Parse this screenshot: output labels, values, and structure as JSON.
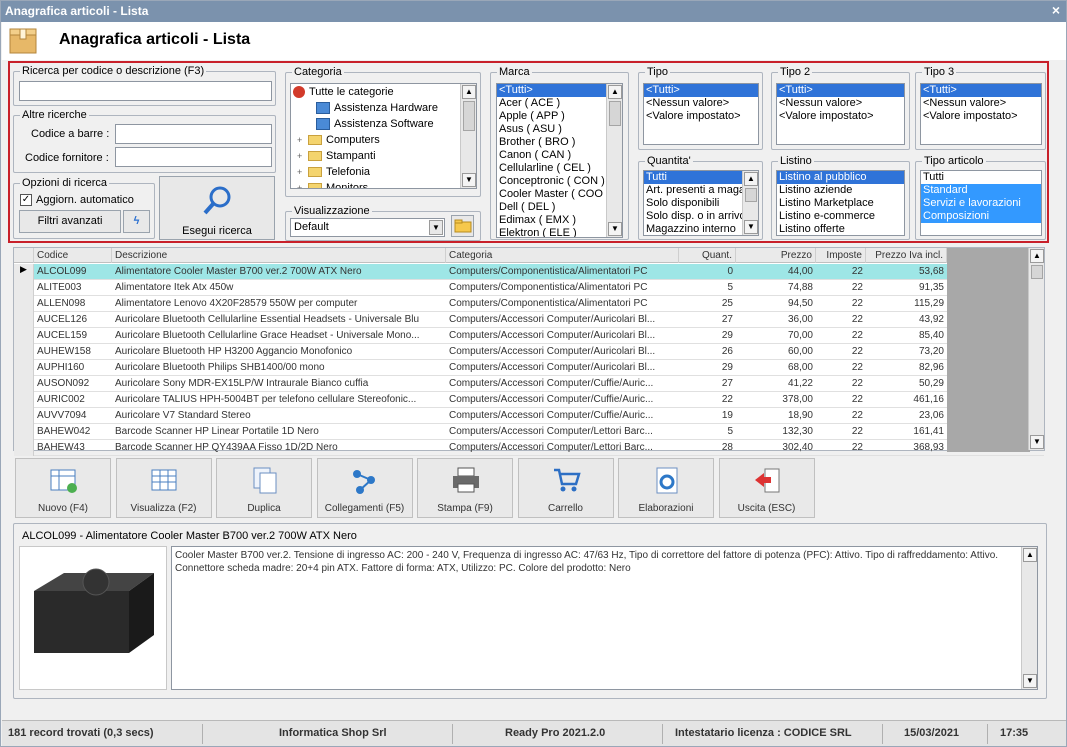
{
  "window": {
    "title": "Anagrafica articoli  - Lista",
    "close": "×"
  },
  "header": {
    "title": "Anagrafica articoli  - Lista"
  },
  "search": {
    "title": "Ricerca per codice o descrizione (F3)",
    "value": "",
    "altre_title": "Altre ricerche",
    "codice_barre_label": "Codice a barre :",
    "codice_fornitore_label": "Codice fornitore :",
    "opzioni_title": "Opzioni di ricerca",
    "aggiorn_label": "Aggiorn. automatico",
    "aggiorn_checked": true,
    "filtri_label": "Filtri avanzati",
    "esegui_label": "Esegui ricerca"
  },
  "categoria": {
    "title": "Categoria",
    "items": [
      {
        "label": "Tutte le categorie",
        "icon": "strawberry-icon",
        "level": 0,
        "expand": ""
      },
      {
        "label": "Assistenza Hardware",
        "icon": "network-icon",
        "level": 1,
        "expand": ""
      },
      {
        "label": "Assistenza Software",
        "icon": "network-icon",
        "level": 1,
        "expand": ""
      },
      {
        "label": "Computers",
        "icon": "folder-icon",
        "level": 1,
        "expand": "+"
      },
      {
        "label": "Stampanti",
        "icon": "folder-icon",
        "level": 1,
        "expand": "+"
      },
      {
        "label": "Telefonia",
        "icon": "folder-icon",
        "level": 1,
        "expand": "+"
      },
      {
        "label": "Monitors",
        "icon": "folder-icon",
        "level": 1,
        "expand": "+"
      }
    ]
  },
  "visualizzazione": {
    "title": "Visualizzazione",
    "value": "Default"
  },
  "marca": {
    "title": "Marca",
    "items": [
      "<Tutti>",
      "Acer ( ACE )",
      "Apple ( APP )",
      "Asus ( ASU )",
      "Brother ( BRO )",
      "Canon ( CAN )",
      "Cellularline ( CEL )",
      "Conceptronic ( CON )",
      "Cooler Master ( COO )",
      "Dell ( DEL )",
      "Edimax ( EMX )",
      "Elektron ( ELE )"
    ],
    "selected": 0
  },
  "tipo": {
    "title": "Tipo",
    "items": [
      "<Tutti>",
      "<Nessun valore>",
      "<Valore impostato>"
    ]
  },
  "tipo2": {
    "title": "Tipo 2",
    "items": [
      "<Tutti>",
      "<Nessun valore>",
      "<Valore impostato>"
    ]
  },
  "tipo3": {
    "title": "Tipo 3",
    "items": [
      "<Tutti>",
      "<Nessun valore>",
      "<Valore impostato>"
    ]
  },
  "quantita": {
    "title": "Quantita'",
    "items": [
      "Tutti",
      "Art. presenti a maga",
      "Solo disponibili",
      "Solo disp. o in arrivo",
      "Magazzino interno"
    ]
  },
  "listino": {
    "title": "Listino",
    "items": [
      "Listino al pubblico",
      "Listino aziende",
      "Listino Marketplace",
      "Listino e-commerce",
      "Listino offerte"
    ]
  },
  "tipo_articolo": {
    "title": "Tipo articolo",
    "items": [
      "Tutti",
      "Standard",
      "Servizi e lavorazioni",
      "Composizioni"
    ]
  },
  "grid": {
    "columns": [
      "Codice",
      "Descrizione",
      "Categoria",
      "Quant.",
      "Prezzo",
      "Imposte",
      "Prezzo Iva incl."
    ],
    "rows": [
      [
        "ALCOL099",
        "Alimentatore Cooler Master B700 ver.2 700W ATX Nero",
        "Computers/Componentistica/Alimentatori PC",
        "0",
        "44,00",
        "22",
        "53,68"
      ],
      [
        "ALITE003",
        "Alimentatore Itek Atx 450w",
        "Computers/Componentistica/Alimentatori PC",
        "5",
        "74,88",
        "22",
        "91,35"
      ],
      [
        "ALLEN098",
        "Alimentatore Lenovo 4X20F28579 550W per computer",
        "Computers/Componentistica/Alimentatori PC",
        "25",
        "94,50",
        "22",
        "115,29"
      ],
      [
        "AUCEL126",
        "Auricolare Bluetooth Cellularline Essential Headsets - Universale Blu",
        "Computers/Accessori Computer/Auricolari Bl...",
        "27",
        "36,00",
        "22",
        "43,92"
      ],
      [
        "AUCEL159",
        "Auricolare Bluetooth Cellularline Grace Headset - Universale Mono...",
        "Computers/Accessori Computer/Auricolari Bl...",
        "29",
        "70,00",
        "22",
        "85,40"
      ],
      [
        "AUHEW158",
        "Auricolare Bluetooth HP H3200 Aggancio Monofonico",
        "Computers/Accessori Computer/Auricolari Bl...",
        "26",
        "60,00",
        "22",
        "73,20"
      ],
      [
        "AUPHI160",
        "Auricolare Bluetooth Philips SHB1400/00 mono",
        "Computers/Accessori Computer/Auricolari Bl...",
        "29",
        "68,00",
        "22",
        "82,96"
      ],
      [
        "AUSON092",
        "Auricolare Sony MDR-EX15LP/W Intraurale Bianco cuffia",
        "Computers/Accessori Computer/Cuffie/Auric...",
        "27",
        "41,22",
        "22",
        "50,29"
      ],
      [
        "AURIC002",
        "Auricolare TALIUS HPH-5004BT per telefono cellulare Stereofonic...",
        "Computers/Accessori Computer/Cuffie/Auric...",
        "22",
        "378,00",
        "22",
        "461,16"
      ],
      [
        "AUVV7094",
        "Auricolare V7 Standard Stereo",
        "Computers/Accessori Computer/Cuffie/Auric...",
        "19",
        "18,90",
        "22",
        "23,06"
      ],
      [
        "BAHEW042",
        "Barcode Scanner HP Linear Portatile 1D Nero",
        "Computers/Accessori Computer/Lettori Barc...",
        "5",
        "132,30",
        "22",
        "161,41"
      ],
      [
        "BAHEW43",
        "Barcode Scanner HP QY439AA Fisso 1D/2D Nero",
        "Computers/Accessori Computer/Lettori Barc...",
        "28",
        "302,40",
        "22",
        "368,93"
      ]
    ]
  },
  "toolbar": [
    {
      "label": "Nuovo (F4)",
      "icon": "new-grid-icon"
    },
    {
      "label": "Visualizza (F2)",
      "icon": "view-grid-icon"
    },
    {
      "label": "Duplica",
      "icon": "duplicate-icon"
    },
    {
      "label": "Collegamenti (F5)",
      "icon": "links-icon"
    },
    {
      "label": "Stampa (F9)",
      "icon": "printer-icon"
    },
    {
      "label": "Carrello",
      "icon": "cart-icon"
    },
    {
      "label": "Elaborazioni",
      "icon": "process-icon"
    },
    {
      "label": "Uscita (ESC)",
      "icon": "exit-icon"
    }
  ],
  "detail": {
    "title": "ALCOL099 - Alimentatore Cooler Master B700 ver.2 700W ATX Nero",
    "text": "Cooler Master B700 ver.2. Tensione di ingresso AC: 200 - 240 V, Frequenza di ingresso AC: 47/63 Hz, Tipo di correttore del fattore di potenza (PFC): Attivo. Tipo di raffreddamento: Attivo. Connettore scheda madre: 20+4 pin ATX. Fattore di forma: ATX, Utilizzo: PC. Colore del prodotto: Nero"
  },
  "status": {
    "records": "181 record trovati (0,3 secs)",
    "company": "Informatica Shop Srl",
    "version": "Ready Pro 2021.2.0",
    "license": "Intestatario licenza : CODICE SRL",
    "date": "15/03/2021",
    "time": "17:35"
  }
}
